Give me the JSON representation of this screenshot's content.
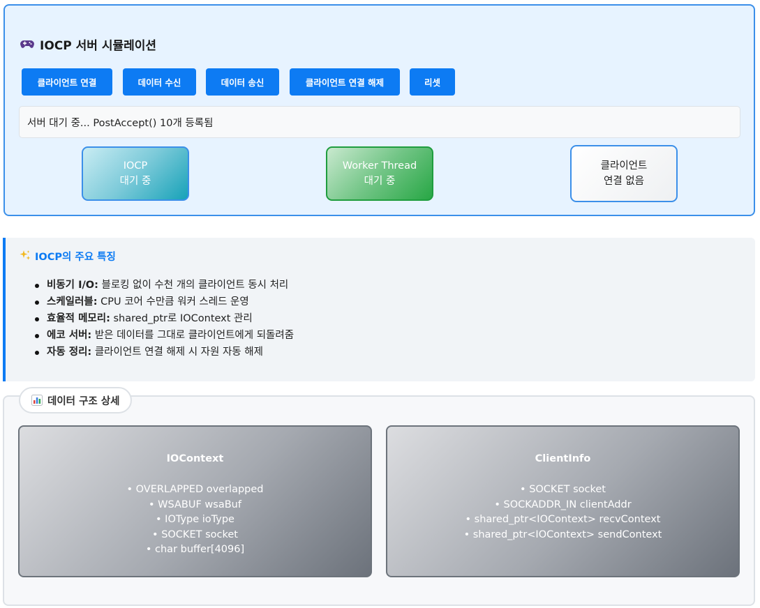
{
  "simulation": {
    "title": "IOCP 서버 시뮬레이션",
    "icon": "gamepad-icon",
    "buttons": [
      {
        "label": "클라이언트 연결"
      },
      {
        "label": "데이터 수신"
      },
      {
        "label": "데이터 송신"
      },
      {
        "label": "클라이언트 연결 해제"
      },
      {
        "label": "리셋"
      }
    ],
    "status": "서버 대기 중... PostAccept() 10개 등록됨",
    "nodes": {
      "iocp": {
        "line1": "IOCP",
        "line2": "대기 중"
      },
      "worker": {
        "line1": "Worker Thread",
        "line2": "대기 중"
      },
      "client": {
        "line1": "클라이언트",
        "line2": "연결 없음"
      }
    }
  },
  "features": {
    "icon": "sparkle-icon",
    "title": "IOCP의 주요 특징",
    "items": [
      {
        "label": "비동기 I/O:",
        "text": " 블로킹 없이 수천 개의 클라이언트 동시 처리"
      },
      {
        "label": "스케일러블:",
        "text": " CPU 코어 수만큼 워커 스레드 운영"
      },
      {
        "label": "효율적 메모리:",
        "text": " shared_ptr로 IOContext 관리"
      },
      {
        "label": "에코 서버:",
        "text": " 받은 데이터를 그대로 클라이언트에게 되돌려줌"
      },
      {
        "label": "자동 정리:",
        "text": " 클라이언트 연결 해제 시 자원 자동 해제"
      }
    ]
  },
  "data_structures": {
    "icon": "bar-chart-icon",
    "legend": "데이터 구조 상세",
    "cards": [
      {
        "title": "IOContext",
        "fields": [
          "• OVERLAPPED overlapped",
          "• WSABUF wsaBuf",
          "• IOType ioType",
          "• SOCKET socket",
          "• char buffer[4096]"
        ]
      },
      {
        "title": "ClientInfo",
        "fields": [
          "• SOCKET socket",
          "• SOCKADDR_IN clientAddr",
          "• shared_ptr<IOContext> recvContext",
          "• shared_ptr<IOContext> sendContext"
        ]
      }
    ]
  },
  "colors": {
    "primary": "#0d7bf3",
    "panel_bg": "#e7f3ff",
    "info": "#17a2b8",
    "success": "#28a745"
  }
}
